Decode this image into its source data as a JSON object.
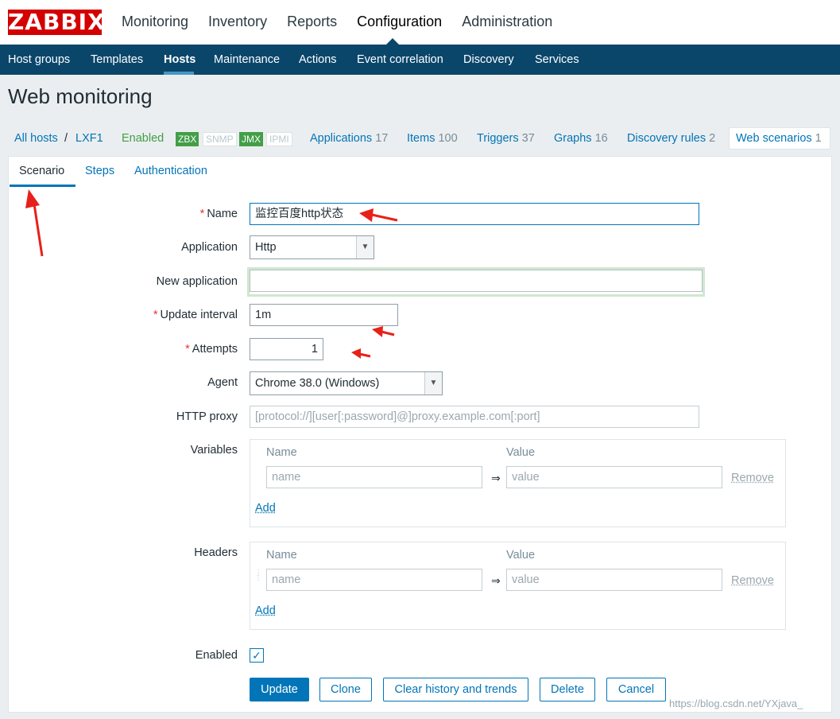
{
  "logo": "ZABBIX",
  "main_menu": [
    "Monitoring",
    "Inventory",
    "Reports",
    "Configuration",
    "Administration"
  ],
  "sub_menu": [
    "Host groups",
    "Templates",
    "Hosts",
    "Maintenance",
    "Actions",
    "Event correlation",
    "Discovery",
    "Services"
  ],
  "page_title": "Web monitoring",
  "host_nav": {
    "all_hosts": "All hosts",
    "separator": "/",
    "host": "LXF1",
    "status": "Enabled",
    "badges": [
      "ZBX",
      "SNMP",
      "JMX",
      "IPMI"
    ],
    "applications": "Applications",
    "applications_count": "17",
    "items": "Items",
    "items_count": "100",
    "triggers": "Triggers",
    "triggers_count": "37",
    "graphs": "Graphs",
    "graphs_count": "16",
    "discovery": "Discovery rules",
    "discovery_count": "2",
    "web": "Web scenarios",
    "web_count": "1"
  },
  "tabs": [
    "Scenario",
    "Steps",
    "Authentication"
  ],
  "form": {
    "name_label": "Name",
    "name_value": "监控百度http状态",
    "application_label": "Application",
    "application_value": "Http",
    "new_application_label": "New application",
    "new_application_value": "",
    "update_interval_label": "Update interval",
    "update_interval_value": "1m",
    "attempts_label": "Attempts",
    "attempts_value": "1",
    "agent_label": "Agent",
    "agent_value": "Chrome 38.0 (Windows)",
    "http_proxy_label": "HTTP proxy",
    "http_proxy_placeholder": "[protocol://][user[:password]@]proxy.example.com[:port]",
    "variables_label": "Variables",
    "headers_label": "Headers",
    "col_name": "Name",
    "col_value": "Value",
    "name_placeholder": "name",
    "value_placeholder": "value",
    "arrow": "⇒",
    "remove": "Remove",
    "add": "Add",
    "enabled_label": "Enabled",
    "enabled_checked": true
  },
  "buttons": [
    "Update",
    "Clone",
    "Clear history and trends",
    "Delete",
    "Cancel"
  ],
  "watermark": "https://blog.csdn.net/YXjava_",
  "colors": {
    "brand": "#d40000",
    "nav": "#0a466a",
    "link": "#0275b8",
    "enabled": "#429e47",
    "annotation": "#e8201a"
  }
}
